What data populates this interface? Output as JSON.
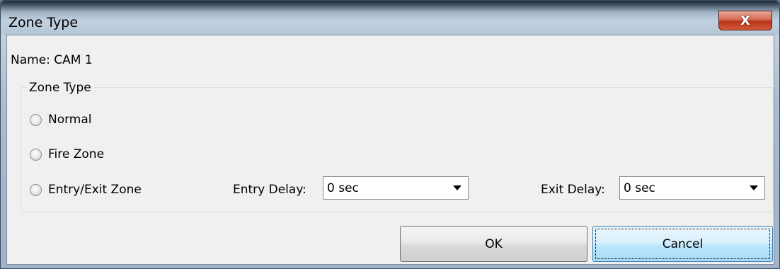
{
  "window": {
    "title": "Zone Type",
    "close_symbol": "X"
  },
  "name_line": "Name: CAM  1",
  "group": {
    "legend": "Zone Type",
    "options": [
      {
        "label": "Normal",
        "selected": false
      },
      {
        "label": "Fire Zone",
        "selected": false
      },
      {
        "label": "Entry/Exit Zone",
        "selected": false
      }
    ],
    "entry_delay": {
      "label": "Entry Delay:",
      "value": "0 sec"
    },
    "exit_delay": {
      "label": "Exit Delay:",
      "value": "0 sec"
    }
  },
  "buttons": {
    "ok": "OK",
    "cancel": "Cancel"
  },
  "colors": {
    "client_bg": "#f0f0f0",
    "close_red": "#c8452a",
    "focused_button_blue": "#bee6fd"
  },
  "icons": {
    "close": "close-icon",
    "dropdown": "chevron-down-icon"
  }
}
